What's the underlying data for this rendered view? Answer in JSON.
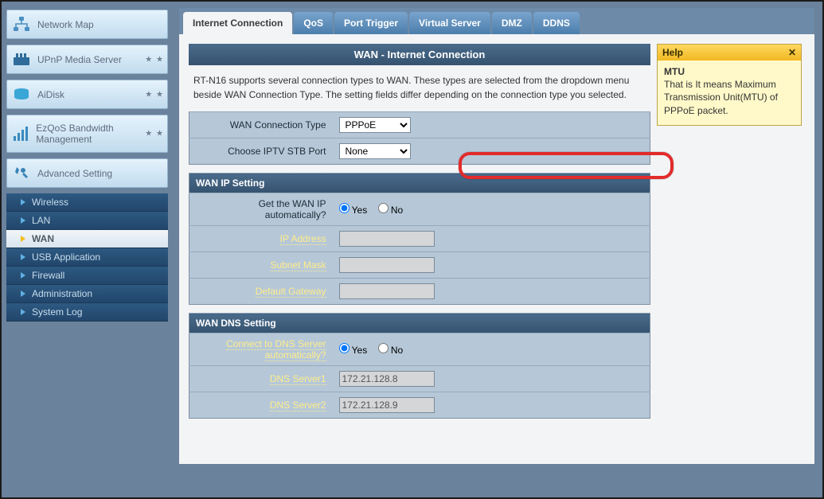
{
  "sidebar": {
    "items": [
      {
        "label": "Network Map"
      },
      {
        "label": "UPnP Media Server"
      },
      {
        "label": "AiDisk"
      },
      {
        "label": "EzQoS Bandwidth Management"
      },
      {
        "label": "Advanced Setting"
      }
    ],
    "sub": [
      {
        "label": "Wireless"
      },
      {
        "label": "LAN"
      },
      {
        "label": "WAN"
      },
      {
        "label": "USB Application"
      },
      {
        "label": "Firewall"
      },
      {
        "label": "Administration"
      },
      {
        "label": "System Log"
      }
    ]
  },
  "tabs": [
    {
      "label": "Internet Connection"
    },
    {
      "label": "QoS"
    },
    {
      "label": "Port Trigger"
    },
    {
      "label": "Virtual Server"
    },
    {
      "label": "DMZ"
    },
    {
      "label": "DDNS"
    }
  ],
  "page": {
    "title": "WAN - Internet Connection",
    "desc": "RT-N16 supports several connection types to WAN. These types are selected from the dropdown menu beside WAN Connection Type. The setting fields differ depending on the connection type you selected."
  },
  "rows": {
    "wan_conn_type_label": "WAN Connection Type",
    "wan_conn_type_value": "PPPoE",
    "iptv_port_label": "Choose IPTV STB Port",
    "iptv_port_value": "None",
    "wan_ip_section": "WAN IP Setting",
    "get_wan_ip_label": "Get the WAN IP automatically?",
    "yes": "Yes",
    "no": "No",
    "ip_address_label": "IP Address",
    "subnet_label": "Subnet Mask",
    "gw_label": "Default Gateway",
    "wan_dns_section": "WAN DNS Setting",
    "dns_auto_label": "Connect to DNS Server automatically?",
    "dns1_label": "DNS Server1",
    "dns1_value": "172.21.128.8",
    "dns2_label": "DNS Server2",
    "dns2_value": "172.21.128.9"
  },
  "help": {
    "head": "Help",
    "title": "MTU",
    "body": "That is It means Maximum Transmission Unit(MTU) of PPPoE packet."
  }
}
